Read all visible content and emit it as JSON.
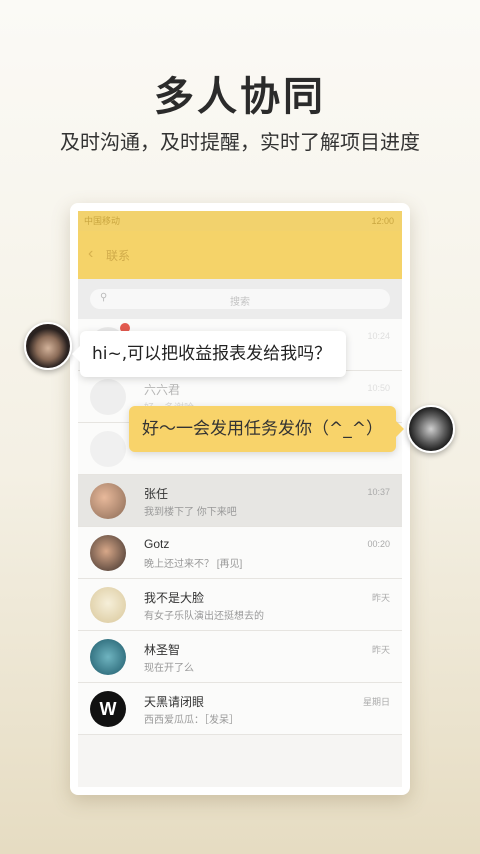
{
  "promo": {
    "title": "多人协同",
    "subtitle": "及时沟通，及时提醒，实时了解项目进度"
  },
  "app": {
    "status_left": "中国移动",
    "status_right": "12:00",
    "nav_title": "联系",
    "search_placeholder": "搜索"
  },
  "chats": [
    {
      "name": "",
      "message": "",
      "time": "10:24",
      "faded": true,
      "badge": true
    },
    {
      "name": "六六君",
      "message": "好，多谢哈",
      "time": "10:50",
      "faded": true
    },
    {
      "name": "",
      "message": "",
      "time": "",
      "faded": true
    },
    {
      "name": "张任",
      "message": "我到楼下了 你下来吧",
      "time": "10:37",
      "selected": true
    },
    {
      "name": "Gotz",
      "message": "晚上还过来不？ [再见]",
      "time": "00:20"
    },
    {
      "name": "我不是大脸",
      "message": "有女子乐队演出还挺想去的",
      "time": "昨天"
    },
    {
      "name": "林圣智",
      "message": "现在开了么",
      "time": "昨天"
    },
    {
      "name": "天黑请闭眼",
      "message": "西西爱瓜瓜：［发呆］",
      "time": "星期日"
    }
  ],
  "bubbles": {
    "left": "hi~,可以把收益报表发给我吗？",
    "right": "好～一会发用任务发你（^_^）"
  },
  "colors": {
    "accent": "#f5d369",
    "bubble_right": "#f8d36a",
    "badge": "#e25a4f"
  }
}
